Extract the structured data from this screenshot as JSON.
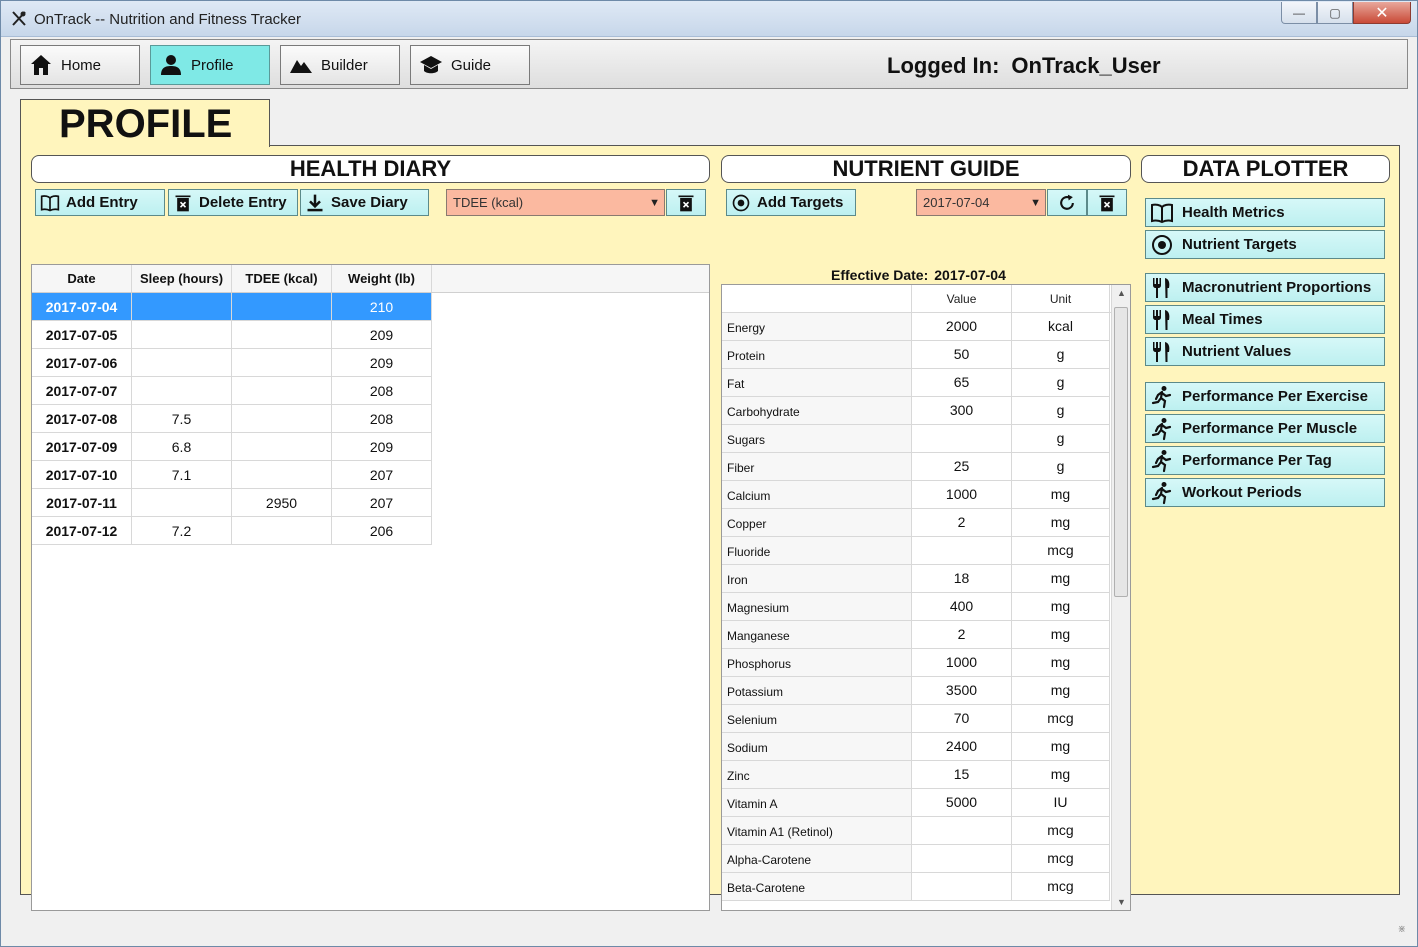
{
  "window": {
    "title": "OnTrack -- Nutrition and Fitness Tracker",
    "close_glyph": "✕",
    "minimize_glyph": "—",
    "maximize_glyph": "▢"
  },
  "nav": {
    "items": [
      {
        "label": "Home",
        "icon": "home-icon"
      },
      {
        "label": "Profile",
        "icon": "person-icon",
        "active": true
      },
      {
        "label": "Builder",
        "icon": "mountain-icon"
      },
      {
        "label": "Guide",
        "icon": "graduation-cap-icon"
      }
    ],
    "logged_in_label": "Logged In:",
    "user": "OnTrack_User",
    "active_color": "#7fe9e6"
  },
  "tab": {
    "title": "PROFILE",
    "background": "#fff5bd"
  },
  "health_diary": {
    "title": "HEALTH DIARY",
    "add_entry": "Add Entry",
    "delete_entry": "Delete Entry",
    "save_diary": "Save Diary",
    "metric_select": "TDEE (kcal)",
    "columns": [
      "Date",
      "Sleep (hours)",
      "TDEE (kcal)",
      "Weight (lb)"
    ],
    "rows": [
      {
        "date": "2017-07-04",
        "sleep": "",
        "tdee": "",
        "weight": "210",
        "selected": true
      },
      {
        "date": "2017-07-05",
        "sleep": "",
        "tdee": "",
        "weight": "209"
      },
      {
        "date": "2017-07-06",
        "sleep": "",
        "tdee": "",
        "weight": "209"
      },
      {
        "date": "2017-07-07",
        "sleep": "",
        "tdee": "",
        "weight": "208"
      },
      {
        "date": "2017-07-08",
        "sleep": "7.5",
        "tdee": "",
        "weight": "208"
      },
      {
        "date": "2017-07-09",
        "sleep": "6.8",
        "tdee": "",
        "weight": "209"
      },
      {
        "date": "2017-07-10",
        "sleep": "7.1",
        "tdee": "",
        "weight": "207"
      },
      {
        "date": "2017-07-11",
        "sleep": "",
        "tdee": "2950",
        "weight": "207"
      },
      {
        "date": "2017-07-12",
        "sleep": "7.2",
        "tdee": "",
        "weight": "206"
      }
    ]
  },
  "nutrient_guide": {
    "title": "NUTRIENT GUIDE",
    "add_targets": "Add Targets",
    "date_select": "2017-07-04",
    "effective_label": "Effective Date:",
    "effective_date": "2017-07-04",
    "columns": [
      "",
      "Value",
      "Unit"
    ],
    "rows": [
      {
        "name": "Energy",
        "value": "2000",
        "unit": "kcal"
      },
      {
        "name": "Protein",
        "value": "50",
        "unit": "g"
      },
      {
        "name": "Fat",
        "value": "65",
        "unit": "g"
      },
      {
        "name": "Carbohydrate",
        "value": "300",
        "unit": "g"
      },
      {
        "name": "Sugars",
        "value": "",
        "unit": "g"
      },
      {
        "name": "Fiber",
        "value": "25",
        "unit": "g"
      },
      {
        "name": "Calcium",
        "value": "1000",
        "unit": "mg"
      },
      {
        "name": "Copper",
        "value": "2",
        "unit": "mg"
      },
      {
        "name": "Fluoride",
        "value": "",
        "unit": "mcg"
      },
      {
        "name": "Iron",
        "value": "18",
        "unit": "mg"
      },
      {
        "name": "Magnesium",
        "value": "400",
        "unit": "mg"
      },
      {
        "name": "Manganese",
        "value": "2",
        "unit": "mg"
      },
      {
        "name": "Phosphorus",
        "value": "1000",
        "unit": "mg"
      },
      {
        "name": "Potassium",
        "value": "3500",
        "unit": "mg"
      },
      {
        "name": "Selenium",
        "value": "70",
        "unit": "mcg"
      },
      {
        "name": "Sodium",
        "value": "2400",
        "unit": "mg"
      },
      {
        "name": "Zinc",
        "value": "15",
        "unit": "mg"
      },
      {
        "name": "Vitamin A",
        "value": "5000",
        "unit": "IU"
      },
      {
        "name": "Vitamin A1 (Retinol)",
        "value": "",
        "unit": "mcg"
      },
      {
        "name": "Alpha-Carotene",
        "value": "",
        "unit": "mcg"
      },
      {
        "name": "Beta-Carotene",
        "value": "",
        "unit": "mcg"
      }
    ]
  },
  "data_plotter": {
    "title": "DATA PLOTTER",
    "groups": [
      [
        {
          "label": "Health Metrics",
          "icon": "book-icon"
        },
        {
          "label": "Nutrient Targets",
          "icon": "target-icon"
        }
      ],
      [
        {
          "label": "Macronutrient Proportions",
          "icon": "fork-knife-icon"
        },
        {
          "label": "Meal Times",
          "icon": "fork-knife-icon"
        },
        {
          "label": "Nutrient Values",
          "icon": "fork-knife-icon"
        }
      ],
      [
        {
          "label": "Performance Per Exercise",
          "icon": "runner-icon"
        },
        {
          "label": "Performance Per Muscle",
          "icon": "runner-icon"
        },
        {
          "label": "Performance Per Tag",
          "icon": "runner-icon"
        },
        {
          "label": "Workout Periods",
          "icon": "runner-icon"
        }
      ]
    ]
  },
  "colors": {
    "panel": "#fff5bd",
    "button": "#bdf0f0",
    "combo": "#fbb9a0",
    "selection": "#3399ff"
  }
}
